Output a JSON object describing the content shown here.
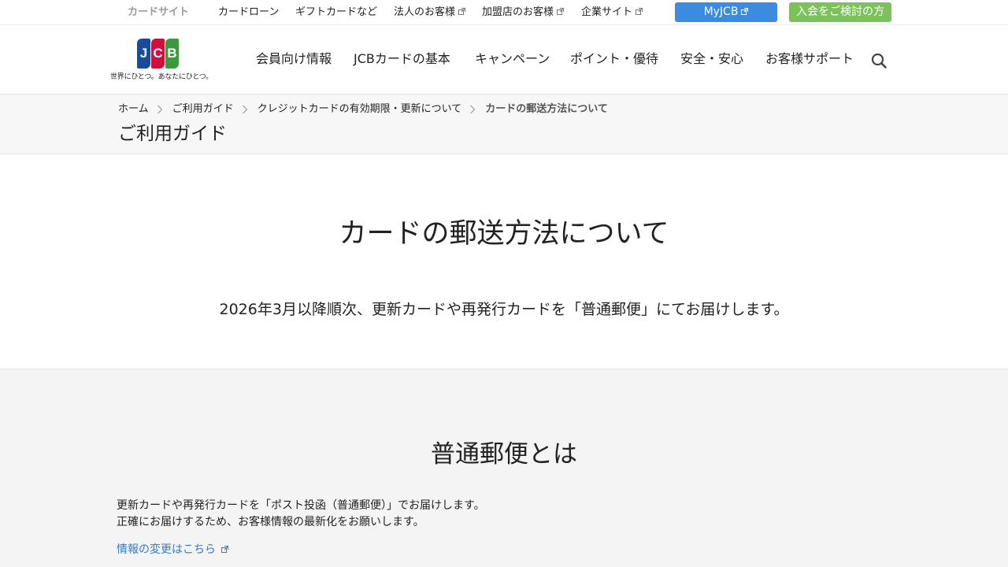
{
  "utility": {
    "current_site": "カードサイト",
    "links": [
      {
        "label": "カードローン",
        "external": false
      },
      {
        "label": "ギフトカードなど",
        "external": false
      },
      {
        "label": "法人のお客様",
        "external": true
      },
      {
        "label": "加盟店のお客様",
        "external": true
      },
      {
        "label": "企業サイト",
        "external": true
      }
    ],
    "myjcb_label": "MyJCB",
    "join_label": "入会をご検討の方"
  },
  "logo": {
    "letters": [
      "J",
      "C",
      "B"
    ],
    "tagline": "世界にひとつ。あなたにひとつ。"
  },
  "gnav": [
    "会員向け情報",
    "JCBカードの基本",
    "キャンペーン",
    "ポイント・優待",
    "安全・安心",
    "お客様サポート"
  ],
  "breadcrumb": [
    "ホーム",
    "ご利用ガイド",
    "クレジットカードの有効期限・更新について",
    "カードの郵送方法について"
  ],
  "section_title": "ご利用ガイド",
  "main": {
    "heading": "カードの郵送方法について",
    "lead": "2026年3月以降順次、更新カードや再発行カードを「普通郵便」にてお届けします。"
  },
  "futsu": {
    "heading": "普通郵便とは",
    "body": [
      "更新カードや再発行カードを「ポスト投函（普通郵便）」でお届けします。",
      "正確にお届けするため、お客様情報の最新化をお願いします。"
    ],
    "link_label": "情報の変更はこちら"
  },
  "colors": {
    "myjcb": "#3d8ae3",
    "join": "#7cc15b",
    "link": "#2f7bd0",
    "logo_blue": "#1a4b9b",
    "logo_red": "#d0103a",
    "logo_green": "#3a9a3d"
  }
}
